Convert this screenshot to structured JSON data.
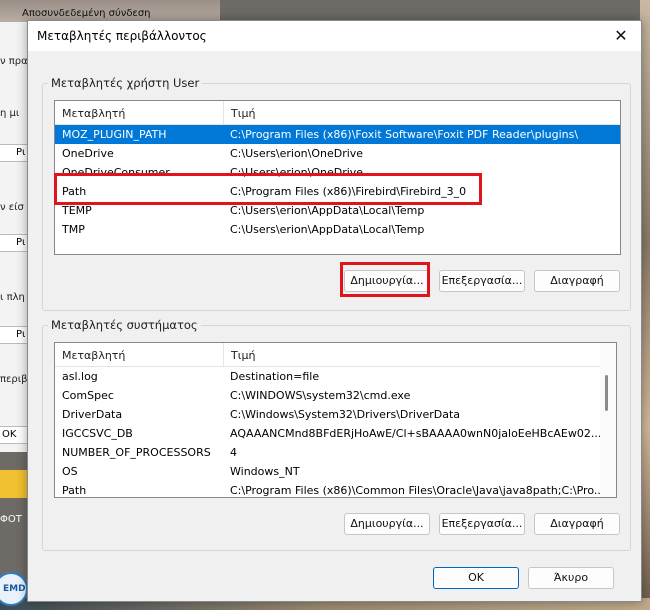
{
  "background": {
    "top_text": "Αποσυνδεδεμένη σύνδεση",
    "fragments": [
      "ν πρα",
      "η μι",
      "Ρι",
      "ν είσ",
      "Ρι",
      "ι πλη",
      "Ρι",
      "περιβ",
      "OK",
      "ΦΟΤ",
      "EMD"
    ]
  },
  "dialog": {
    "title": "Μεταβλητές περιβάλλοντος",
    "close_symbol": "✕",
    "user_group": {
      "label": "Μεταβλητές χρήστη User",
      "headers": {
        "variable": "Μεταβλητή",
        "value": "Τιμή"
      },
      "rows": [
        {
          "name": "MOZ_PLUGIN_PATH",
          "value": "C:\\Program Files (x86)\\Foxit Software\\Foxit PDF Reader\\plugins\\",
          "selected": true
        },
        {
          "name": "OneDrive",
          "value": "C:\\Users\\erion\\OneDrive"
        },
        {
          "name": "OneDriveConsumer",
          "value": "C:\\Users\\erion\\OneDrive"
        },
        {
          "name": "Path",
          "value": "C:\\Program Files (x86)\\Firebird\\Firebird_3_0"
        },
        {
          "name": "TEMP",
          "value": "C:\\Users\\erion\\AppData\\Local\\Temp"
        },
        {
          "name": "TMP",
          "value": "C:\\Users\\erion\\AppData\\Local\\Temp"
        }
      ],
      "buttons": {
        "new": "Δημιουργία...",
        "edit": "Επεξεργασία...",
        "delete": "Διαγραφή"
      }
    },
    "system_group": {
      "label": "Μεταβλητές συστήματος",
      "headers": {
        "variable": "Μεταβλητή",
        "value": "Τιμή"
      },
      "rows": [
        {
          "name": "asl.log",
          "value": "Destination=file"
        },
        {
          "name": "ComSpec",
          "value": "C:\\WINDOWS\\system32\\cmd.exe"
        },
        {
          "name": "DriverData",
          "value": "C:\\Windows\\System32\\Drivers\\DriverData"
        },
        {
          "name": "IGCCSVC_DB",
          "value": "AQAAANCMnd8BFdERjHoAwE/Cl+sBAAAA0wnN0jaloEeHBcAEw02..."
        },
        {
          "name": "NUMBER_OF_PROCESSORS",
          "value": "4"
        },
        {
          "name": "OS",
          "value": "Windows_NT"
        },
        {
          "name": "Path",
          "value": "C:\\Program Files (x86)\\Common Files\\Oracle\\Java\\java8path;C:\\Pro..."
        }
      ],
      "buttons": {
        "new": "Δημιουργία...",
        "edit": "Επεξεργασία...",
        "delete": "Διαγραφή"
      }
    },
    "footer": {
      "ok": "OK",
      "cancel": "Άκυρο"
    }
  },
  "colors": {
    "selection": "#0078d7",
    "highlight": "#e0151b",
    "default_border": "#0067c0"
  }
}
